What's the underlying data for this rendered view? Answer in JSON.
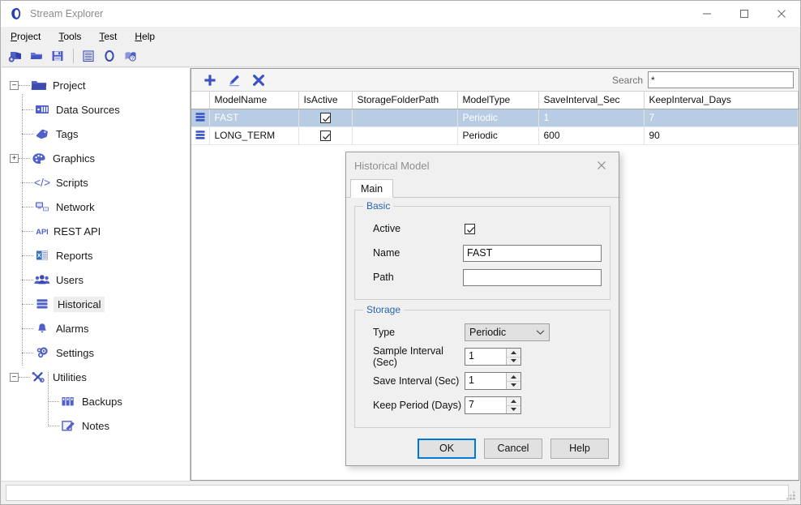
{
  "window": {
    "title": "Stream Explorer",
    "logo_icon": "ring-logo-icon",
    "minimize_label": "Minimize",
    "maximize_label": "Maximize",
    "close_label": "Close"
  },
  "menubar": {
    "items": [
      {
        "label": "Project",
        "accel": "P"
      },
      {
        "label": "Tools",
        "accel": "T"
      },
      {
        "label": "Test",
        "accel": "T"
      },
      {
        "label": "Help",
        "accel": "H"
      }
    ]
  },
  "toolbar": {
    "buttons": [
      {
        "name": "new-project-icon",
        "tooltip": "New Project"
      },
      {
        "name": "open-folder-icon",
        "tooltip": "Open"
      },
      {
        "name": "save-icon",
        "tooltip": "Save"
      },
      {
        "name": "report-list-icon",
        "tooltip": "List"
      },
      {
        "name": "ring-logo-icon",
        "tooltip": "About"
      },
      {
        "name": "help-book-icon",
        "tooltip": "Help"
      }
    ]
  },
  "sidebar": {
    "root": {
      "label": "Project",
      "icon": "folder-icon",
      "expander": "minus"
    },
    "items": [
      {
        "label": "Data Sources",
        "icon": "data-sources-icon",
        "expander": "none",
        "selected": false
      },
      {
        "label": "Tags",
        "icon": "tag-icon",
        "expander": "none",
        "selected": false
      },
      {
        "label": "Graphics",
        "icon": "palette-icon",
        "expander": "plus",
        "selected": false
      },
      {
        "label": "Scripts",
        "icon": "code-icon",
        "expander": "none",
        "selected": false
      },
      {
        "label": "Network",
        "icon": "network-icon",
        "expander": "none",
        "selected": false
      },
      {
        "label": "REST API",
        "icon": "api-icon",
        "expander": "none",
        "selected": false
      },
      {
        "label": "Reports",
        "icon": "excel-report-icon",
        "expander": "none",
        "selected": false
      },
      {
        "label": "Users",
        "icon": "users-icon",
        "expander": "none",
        "selected": false
      },
      {
        "label": "Historical",
        "icon": "historical-icon",
        "expander": "none",
        "selected": true
      },
      {
        "label": "Alarms",
        "icon": "bell-icon",
        "expander": "none",
        "selected": false
      },
      {
        "label": "Settings",
        "icon": "gears-icon",
        "expander": "none",
        "selected": false
      },
      {
        "label": "Utilities",
        "icon": "tools-icon",
        "expander": "minus",
        "selected": false
      }
    ],
    "children": [
      {
        "label": "Backups",
        "icon": "backups-icon",
        "selected": false
      },
      {
        "label": "Notes",
        "icon": "notes-icon",
        "selected": false
      }
    ]
  },
  "content": {
    "actions": [
      {
        "name": "add-icon",
        "label": "Add"
      },
      {
        "name": "edit-pencil-icon",
        "label": "Edit"
      },
      {
        "name": "delete-x-icon",
        "label": "Delete"
      }
    ],
    "search": {
      "label": "Search",
      "value": "*",
      "placeholder": ""
    },
    "grid": {
      "columns": [
        "ModelName",
        "IsActive",
        "StorageFolderPath",
        "ModelType",
        "SaveInterval_Sec",
        "KeepInterval_Days"
      ],
      "rows": [
        {
          "icon": "historical-row-icon",
          "selected": true,
          "ModelName": "FAST",
          "IsActive": true,
          "StorageFolderPath": "",
          "ModelType": "Periodic",
          "SaveInterval_Sec": "1",
          "KeepInterval_Days": "7"
        },
        {
          "icon": "historical-row-icon",
          "selected": false,
          "ModelName": "LONG_TERM",
          "IsActive": true,
          "StorageFolderPath": "",
          "ModelType": "Periodic",
          "SaveInterval_Sec": "600",
          "KeepInterval_Days": "90"
        }
      ]
    }
  },
  "dialog": {
    "title": "Historical Model",
    "close_label": "Close",
    "tabs": [
      {
        "label": "Main",
        "active": true
      }
    ],
    "basic": {
      "legend": "Basic",
      "active_label": "Active",
      "active_checked": true,
      "name_label": "Name",
      "name_value": "FAST",
      "path_label": "Path",
      "path_value": ""
    },
    "storage": {
      "legend": "Storage",
      "type_label": "Type",
      "type_value": "Periodic",
      "sample_label": "Sample Interval (Sec)",
      "sample_value": "1",
      "save_label": "Save Interval (Sec)",
      "save_value": "1",
      "keep_label": "Keep Period (Days)",
      "keep_value": "7"
    },
    "buttons": {
      "ok": "OK",
      "cancel": "Cancel",
      "help": "Help"
    }
  },
  "statusbar": {
    "text": "",
    "grip_icon": "resize-grip-icon"
  },
  "colors": {
    "accent": "#3a52c8",
    "selection": "#b8cce4",
    "legend": "#2864b4",
    "default_button_border": "#0078d7"
  }
}
